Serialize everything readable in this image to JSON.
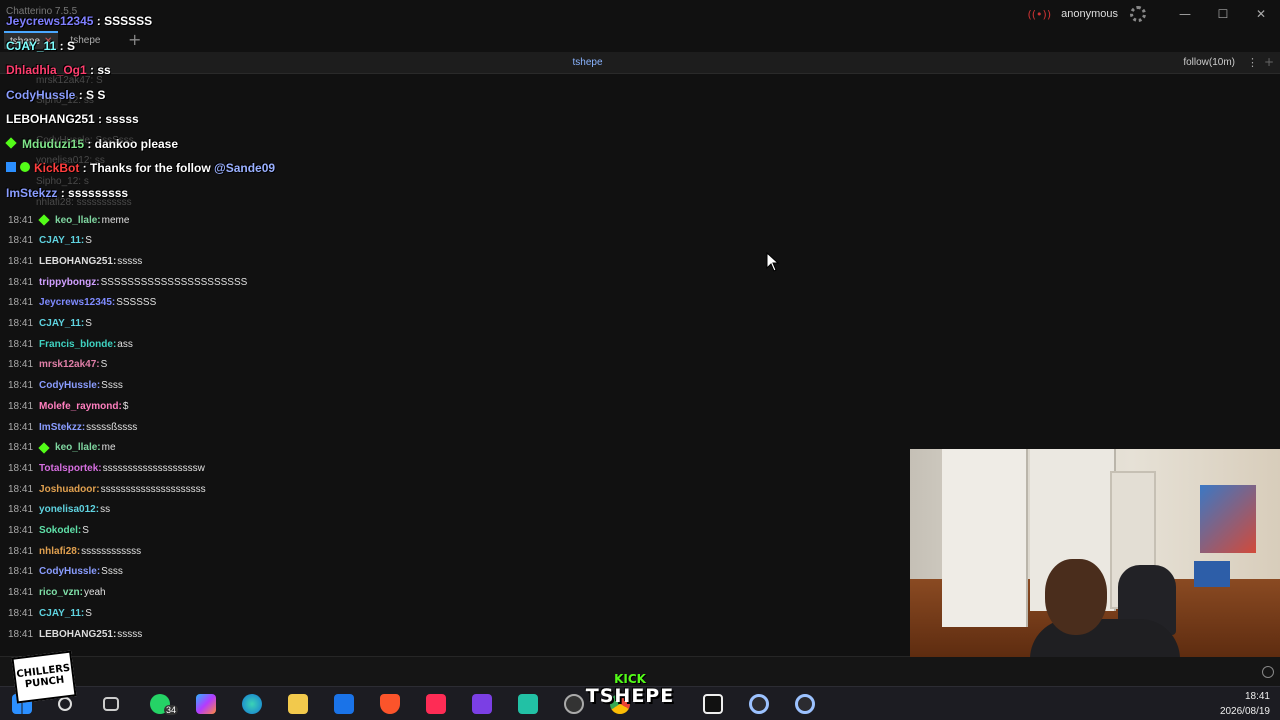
{
  "app": {
    "title": "Chatterino 7.5.5",
    "username": "anonymous"
  },
  "tabs": [
    {
      "label": "tshepe",
      "active": true
    },
    {
      "label": "tshepe",
      "active": false
    }
  ],
  "split": {
    "channel": "tshepe",
    "mode": "follow(10m)"
  },
  "overlay_chat": [
    {
      "nick": "Jeycrews12345",
      "text": "SSSSSS",
      "color": "#7f7fff"
    },
    {
      "nick": "CJAY_11",
      "text": "S",
      "color": "#7fffff"
    },
    {
      "nick": "Dhladhla_Og1",
      "text": "ss",
      "color": "#ff3e6e"
    },
    {
      "nick": "CodyHussle",
      "text": "S S",
      "color": "#8a9dff"
    },
    {
      "nick": "LEBOHANG251",
      "text": "sssss",
      "color": "#ffffff"
    },
    {
      "nick": "Mduduzi15",
      "text": "dankoo please",
      "color": "#7fe68a"
    },
    {
      "nick": "KickBot",
      "text": "Thanks for the follow",
      "mention": "@Sande09",
      "color": "#ff3e3e"
    },
    {
      "nick": "ImStekzz",
      "text": "sssssssss",
      "color": "#8a9dff"
    }
  ],
  "ghost_rows": [
    {
      "text": "mrsk12ak47: S"
    },
    {
      "text": "Sipho_12: ss"
    },
    {
      "text": "CodyHussle: SssSsss"
    },
    {
      "text": "yonelisa012: ss"
    },
    {
      "text": "Sipho_12: s"
    },
    {
      "text": "nhlafi28: sssssssssss"
    }
  ],
  "messages": [
    {
      "time": "18:41",
      "nick": "keo_llale",
      "text": "meme",
      "color": "#7fd6a0",
      "badge": true
    },
    {
      "time": "18:41",
      "nick": "CJAY_11",
      "text": "S",
      "color": "#5fd3e0"
    },
    {
      "time": "18:41",
      "nick": "LEBOHANG251",
      "text": "sssss",
      "color": "#dddddd"
    },
    {
      "time": "18:41",
      "nick": "trippybongz",
      "text": "SSSSSSSSSSSSSSSSSSSSSS",
      "color": "#d1a0ff"
    },
    {
      "time": "18:41",
      "nick": "Jeycrews12345",
      "text": "SSSSSS",
      "color": "#7f8bff"
    },
    {
      "time": "18:41",
      "nick": "CJAY_11",
      "text": "S",
      "color": "#5fd3e0"
    },
    {
      "time": "18:41",
      "nick": "Francis_blonde",
      "text": "ass",
      "color": "#3fd3c2"
    },
    {
      "time": "18:41",
      "nick": "mrsk12ak47",
      "text": "S",
      "color": "#e07fa8"
    },
    {
      "time": "18:41",
      "nick": "CodyHussle",
      "text": "Ssss",
      "color": "#8a9dff"
    },
    {
      "time": "18:41",
      "nick": "Molefe_raymond",
      "text": "$",
      "color": "#ff7fbf"
    },
    {
      "time": "18:41",
      "nick": "ImStekzz",
      "text": "sssssßssss",
      "color": "#8a9dff"
    },
    {
      "time": "18:41",
      "nick": "keo_llale",
      "text": "me",
      "color": "#7fd6a0",
      "badge": true
    },
    {
      "time": "18:41",
      "nick": "Totalsportek",
      "text": "sssssssssssssssssssw",
      "color": "#d66fe0"
    },
    {
      "time": "18:41",
      "nick": "Joshuadoor",
      "text": "sssssssssssssssssssss",
      "color": "#e0a04f"
    },
    {
      "time": "18:41",
      "nick": "yonelisa012",
      "text": "ss",
      "color": "#5fd3e0"
    },
    {
      "time": "18:41",
      "nick": "Sokodel",
      "text": "S",
      "color": "#5fe0a8"
    },
    {
      "time": "18:41",
      "nick": "nhlafi28",
      "text": "ssssssssssss",
      "color": "#e0a04f"
    },
    {
      "time": "18:41",
      "nick": "CodyHussle",
      "text": "Ssss",
      "color": "#8a9dff"
    },
    {
      "time": "18:41",
      "nick": "rico_vzn",
      "text": "yeah",
      "color": "#7fe0a8"
    },
    {
      "time": "18:41",
      "nick": "CJAY_11",
      "text": "S",
      "color": "#5fd3e0"
    },
    {
      "time": "18:41",
      "nick": "LEBOHANG251",
      "text": "sssss",
      "color": "#dddddd"
    }
  ],
  "overlay_logo": {
    "line1": "CHILLERS",
    "line2": "PUNCH"
  },
  "kick": {
    "word": "KICK",
    "name": "TSHEPE"
  },
  "taskbar": {
    "clock_time": "18:41",
    "clock_date": "2026/08/19",
    "whatsapp_count": "34"
  }
}
